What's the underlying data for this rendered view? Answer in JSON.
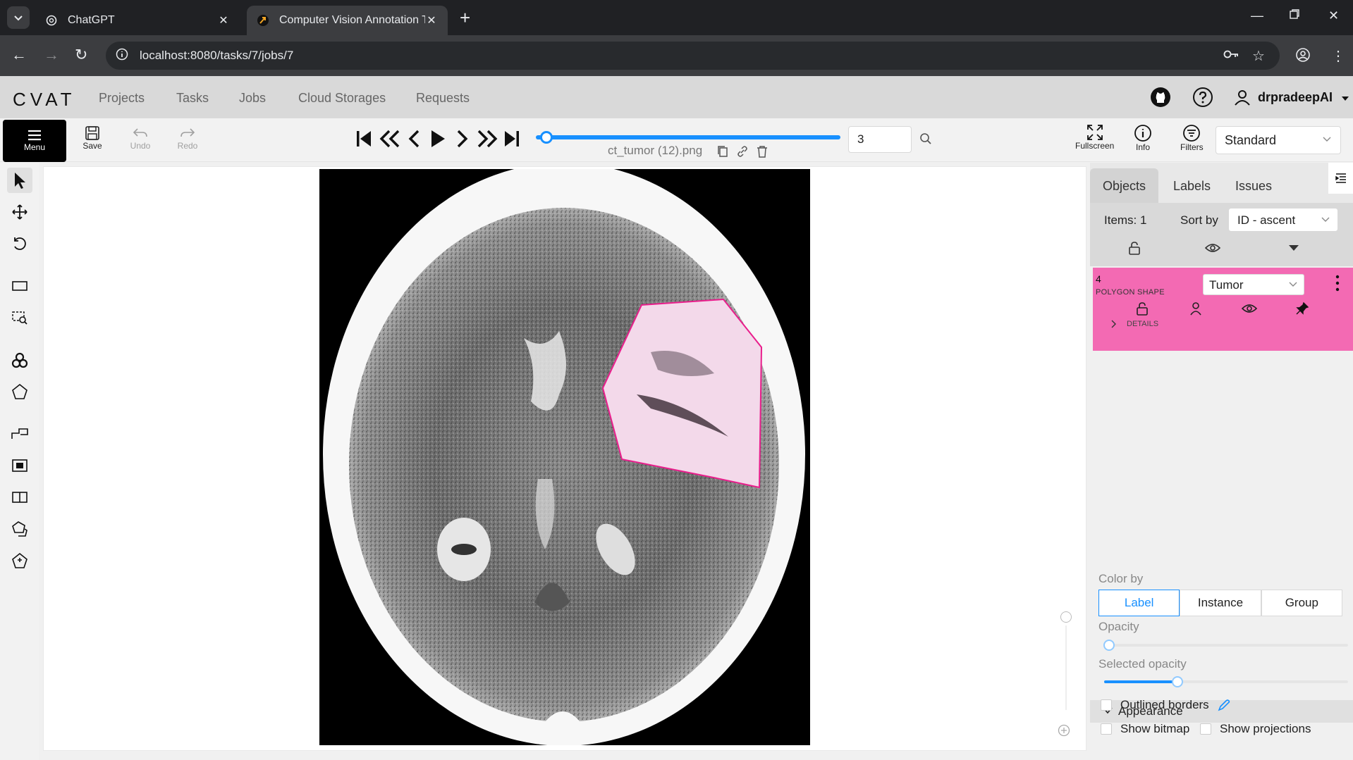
{
  "browser": {
    "tabs": [
      {
        "title": "ChatGPT",
        "active": false
      },
      {
        "title": "Computer Vision Annotation Tool",
        "active": true
      }
    ],
    "url": "localhost:8080/tasks/7/jobs/7"
  },
  "header": {
    "logo": "CVAT",
    "nav": [
      "Projects",
      "Tasks",
      "Jobs",
      "Cloud Storages",
      "Requests"
    ],
    "username": "drpradeepAI"
  },
  "toolbar": {
    "menu_label": "Menu",
    "save_label": "Save",
    "undo_label": "Undo",
    "redo_label": "Redo",
    "filename": "ct_tumor (12).png",
    "frame_number": "3",
    "fullscreen_label": "Fullscreen",
    "info_label": "Info",
    "filters_label": "Filters",
    "workspace": "Standard",
    "frame_progress": 0.035
  },
  "panel": {
    "tabs": [
      "Objects",
      "Labels",
      "Issues"
    ],
    "items_count": "Items: 1",
    "sort_label": "Sort by",
    "sort_value": "ID - ascent",
    "object": {
      "id": "4",
      "type": "POLYGON SHAPE",
      "label": "Tumor",
      "details_label": "DETAILS",
      "color": "#f36ab3"
    },
    "appearance": {
      "title": "Appearance",
      "color_by_label": "Color by",
      "color_by_options": [
        "Label",
        "Instance",
        "Group"
      ],
      "color_by_selected": "Label",
      "opacity_label": "Opacity",
      "opacity_value": 0.02,
      "selected_opacity_label": "Selected opacity",
      "selected_opacity_value": 0.3,
      "outlined_borders_label": "Outlined borders",
      "show_bitmap_label": "Show bitmap",
      "show_projections_label": "Show projections"
    }
  },
  "colors": {
    "accent": "#1890ff",
    "annotation": "#e91e8c",
    "browser_dark": "#202124"
  }
}
